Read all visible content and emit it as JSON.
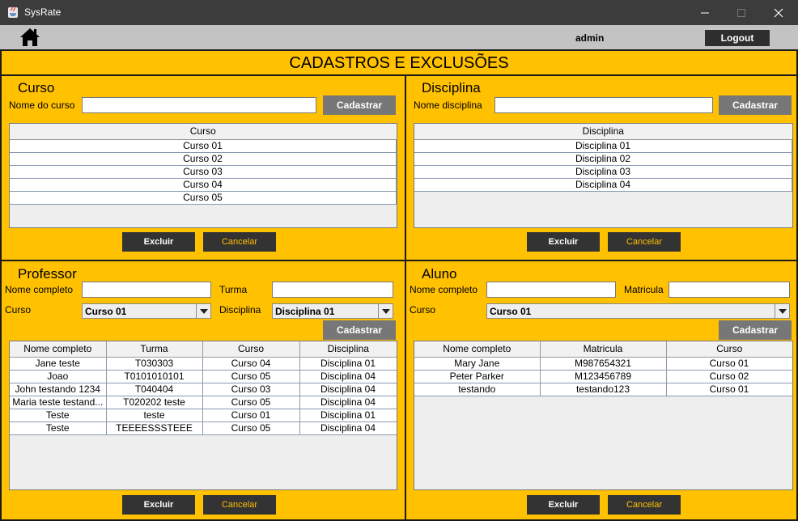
{
  "window": {
    "title": "SysRate"
  },
  "topbar": {
    "user": "admin",
    "logout": "Logout"
  },
  "main": {
    "title": "CADASTROS E EXCLUSÕES"
  },
  "curso": {
    "title": "Curso",
    "name_label": "Nome do curso",
    "name_value": "",
    "add": "Cadastrar",
    "columns": [
      "Curso"
    ],
    "rows": [
      [
        "Curso 01"
      ],
      [
        "Curso 02"
      ],
      [
        "Curso 03"
      ],
      [
        "Curso 04"
      ],
      [
        "Curso 05"
      ]
    ],
    "delete": "Excluir",
    "cancel": "Cancelar"
  },
  "disciplina": {
    "title": "Disciplina",
    "name_label": "Nome disciplina",
    "name_value": "",
    "add": "Cadastrar",
    "columns": [
      "Disciplina"
    ],
    "rows": [
      [
        "Disciplina 01"
      ],
      [
        "Disciplina 02"
      ],
      [
        "Disciplina 03"
      ],
      [
        "Disciplina 04"
      ]
    ],
    "delete": "Excluir",
    "cancel": "Cancelar"
  },
  "professor": {
    "title": "Professor",
    "name_label": "Nome completo",
    "turma_label": "Turma",
    "curso_label": "Curso",
    "curso_selected": "Curso 01",
    "disciplina_label": "Disciplina",
    "disciplina_selected": "Disciplina 01",
    "add": "Cadastrar",
    "columns": [
      "Nome completo",
      "Turma",
      "Curso",
      "Disciplina"
    ],
    "rows": [
      [
        "Jane teste",
        "T030303",
        "Curso 04",
        "Disciplina 01"
      ],
      [
        "Joao",
        "T0101010101",
        "Curso 05",
        "Disciplina 04"
      ],
      [
        "John testando 1234",
        "T040404",
        "Curso 03",
        "Disciplina 04"
      ],
      [
        "Maria teste testand...",
        "T020202 teste",
        "Curso 05",
        "Disciplina 04"
      ],
      [
        "Teste",
        "teste",
        "Curso 01",
        "Disciplina 01"
      ],
      [
        "Teste",
        "TEEEESSSTEEE",
        "Curso 05",
        "Disciplina 04"
      ]
    ],
    "delete": "Excluir",
    "cancel": "Cancelar"
  },
  "aluno": {
    "title": "Aluno",
    "name_label": "Nome completo",
    "matricula_label": "Matricula",
    "curso_label": "Curso",
    "curso_selected": "Curso 01",
    "add": "Cadastrar",
    "columns": [
      "Nome completo",
      "Matricula",
      "Curso"
    ],
    "rows": [
      [
        "Mary Jane",
        "M987654321",
        "Curso 01"
      ],
      [
        "Peter Parker",
        "M123456789",
        "Curso 02"
      ],
      [
        "testando",
        "testando123",
        "Curso 01"
      ]
    ],
    "delete": "Excluir",
    "cancel": "Cancelar"
  },
  "colors": {
    "accent": "#ffc100",
    "dark_button": "#333333",
    "gray_button": "#777777"
  }
}
